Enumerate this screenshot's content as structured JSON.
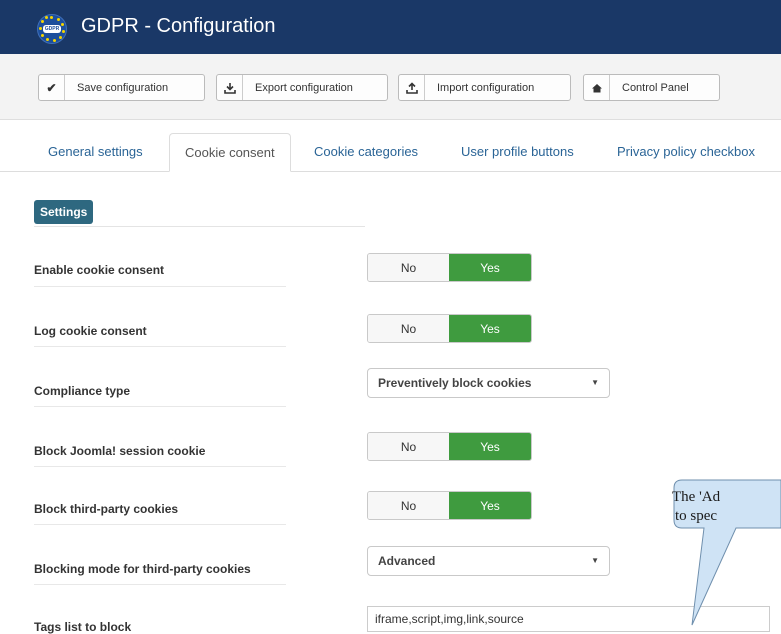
{
  "header": {
    "title": "GDPR - Configuration",
    "logo_text": "GDPR"
  },
  "toolbar": {
    "buttons": [
      {
        "icon": "check-icon",
        "label": "Save configuration"
      },
      {
        "icon": "download-icon",
        "label": "Export configuration"
      },
      {
        "icon": "upload-icon",
        "label": "Import configuration"
      },
      {
        "icon": "home-icon",
        "label": "Control Panel"
      }
    ]
  },
  "tabs": [
    {
      "label": "General settings",
      "active": false
    },
    {
      "label": "Cookie consent",
      "active": true
    },
    {
      "label": "Cookie categories",
      "active": false
    },
    {
      "label": "User profile buttons",
      "active": false
    },
    {
      "label": "Privacy policy checkbox",
      "active": false
    }
  ],
  "section": {
    "title": "Settings"
  },
  "fields": {
    "enable_cookie_consent": {
      "label": "Enable cookie consent",
      "no": "No",
      "yes": "Yes",
      "value": "Yes"
    },
    "log_cookie_consent": {
      "label": "Log cookie consent",
      "no": "No",
      "yes": "Yes",
      "value": "Yes"
    },
    "compliance_type": {
      "label": "Compliance type",
      "value": "Preventively block cookies"
    },
    "block_joomla_session_cookie": {
      "label": "Block Joomla! session cookie",
      "no": "No",
      "yes": "Yes",
      "value": "Yes"
    },
    "block_third_party_cookies": {
      "label": "Block third-party cookies",
      "no": "No",
      "yes": "Yes",
      "value": "Yes"
    },
    "blocking_mode": {
      "label": "Blocking mode for third-party cookies",
      "value": "Advanced"
    },
    "tags_list": {
      "label": "Tags list to block",
      "value": "iframe,script,img,link,source"
    }
  },
  "callout": {
    "line1": "The 'Ad",
    "line2": "to spec"
  },
  "colors": {
    "header_bg": "#1a3867",
    "toggle_yes": "#3f9b3f",
    "badge_bg": "#2e6880",
    "link": "#2a6496",
    "callout_fill": "#cfe3f5",
    "callout_stroke": "#6f8fad"
  }
}
